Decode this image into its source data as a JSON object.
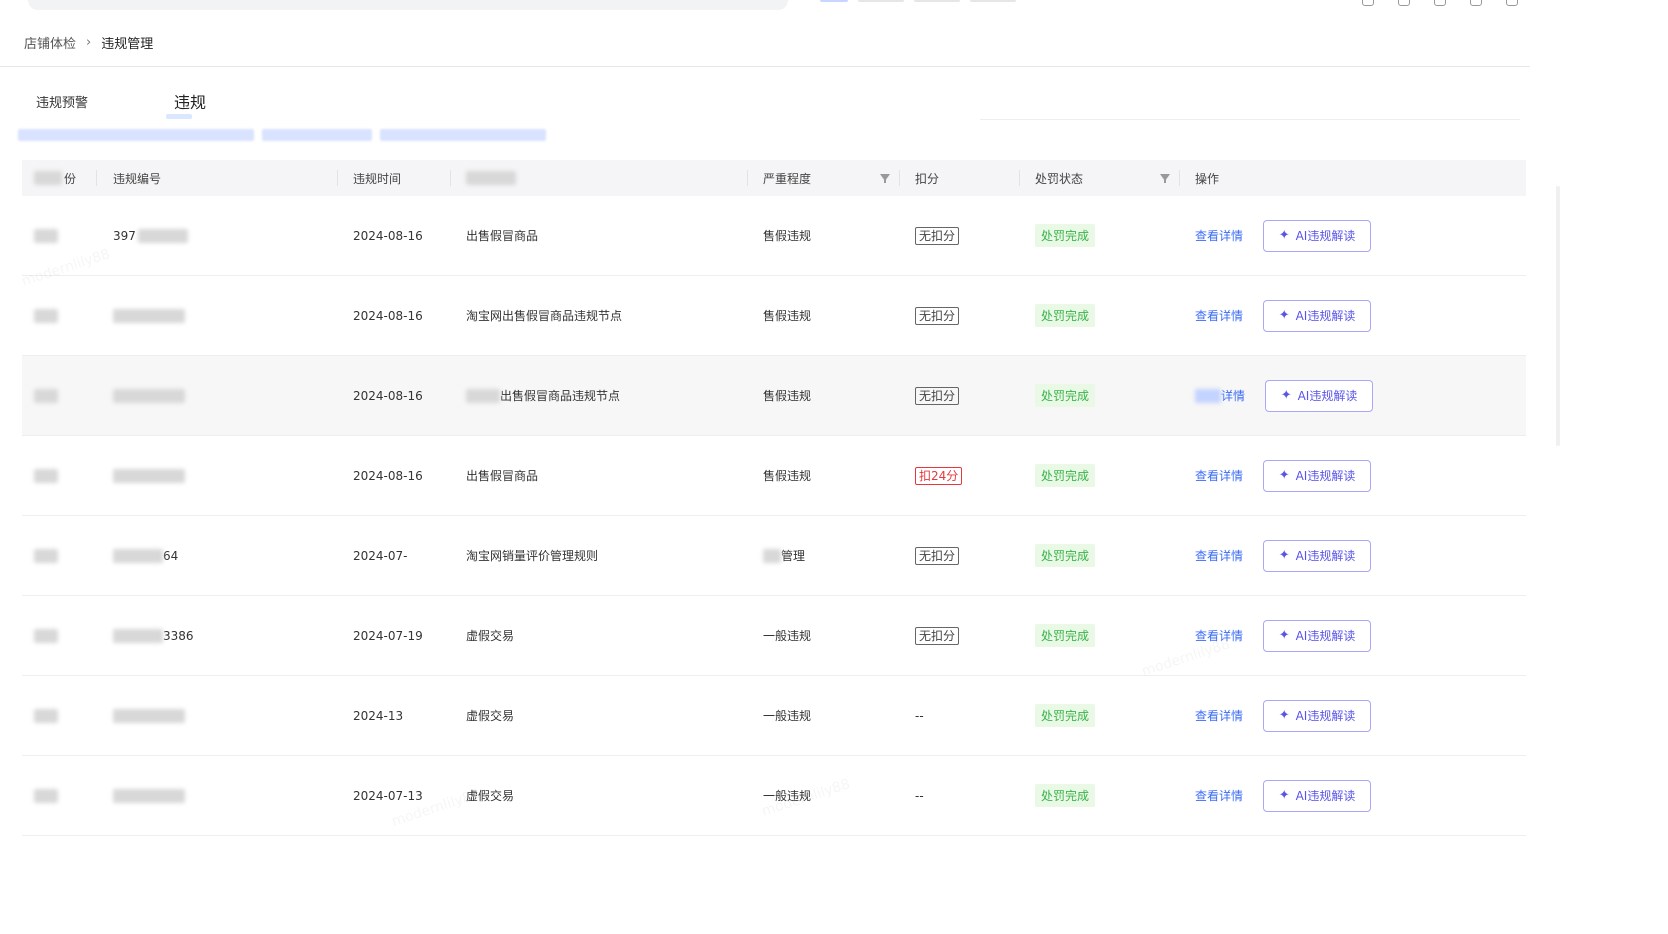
{
  "breadcrumb": {
    "items": [
      "店铺体检",
      "违规管理"
    ],
    "separator": "›"
  },
  "tabs": [
    {
      "label": "违规预警",
      "active": false
    },
    {
      "label": "违规",
      "active": true
    }
  ],
  "table": {
    "columns": [
      "身份",
      "违规编号",
      "违规时间",
      "违规名称",
      "严重程度",
      "扣分",
      "处罚状态",
      "操作"
    ],
    "rows": [
      {
        "id_suffix": "397",
        "date": "2024-08-16",
        "name": "出售假冒商品",
        "severity": "售假违规",
        "score": "无扣分",
        "status": "处罚完成",
        "detail": "查看详情",
        "ai": "AI违规解读"
      },
      {
        "id_suffix": "",
        "date": "2024-08-16",
        "name": "淘宝网出售假冒商品违规节点",
        "severity": "售假违规",
        "score": "无扣分",
        "status": "处罚完成",
        "detail": "查看详情",
        "ai": "AI违规解读"
      },
      {
        "id_suffix": "",
        "date": "2024-08-16",
        "name": "出售假冒商品违规节点",
        "severity": "售假违规",
        "score": "无扣分",
        "status": "处罚完成",
        "detail": "详情",
        "ai": "AI违规解读"
      },
      {
        "id_suffix": "",
        "date": "2024-08-16",
        "name": "出售假冒商品",
        "severity": "售假违规",
        "score": "扣24分",
        "status": "处罚完成",
        "detail": "查看详情",
        "ai": "AI违规解读"
      },
      {
        "id_suffix": "64",
        "date": "2024-07-",
        "name": "淘宝网销量评价管理规则",
        "severity": "管理",
        "score": "无扣分",
        "status": "处罚完成",
        "detail": "查看详情",
        "ai": "AI违规解读"
      },
      {
        "id_suffix": "3386",
        "date": "2024-07-19",
        "name": "虚假交易",
        "severity": "一般违规",
        "score": "无扣分",
        "status": "处罚完成",
        "detail": "查看详情",
        "ai": "AI违规解读"
      },
      {
        "id_suffix": "",
        "date": "2024-13",
        "name": "虚假交易",
        "severity": "一般违规",
        "score": "--",
        "status": "处罚完成",
        "detail": "查看详情",
        "ai": "AI违规解读"
      },
      {
        "id_suffix": "",
        "date": "2024-07-13",
        "name": "虚假交易",
        "severity": "一般违规",
        "score": "--",
        "status": "处罚完成",
        "detail": "查看详情",
        "ai": "AI违规解读"
      }
    ]
  },
  "colors": {
    "link": "#3b6cf6",
    "status_green": "#39b54a",
    "penalty_red": "#e4393c",
    "ai_purple": "#5a54e8"
  },
  "icons": {
    "ai_button": "sparkle-icon",
    "filter": "filter-icon",
    "breadcrumb_separator": "chevron-right-icon"
  }
}
